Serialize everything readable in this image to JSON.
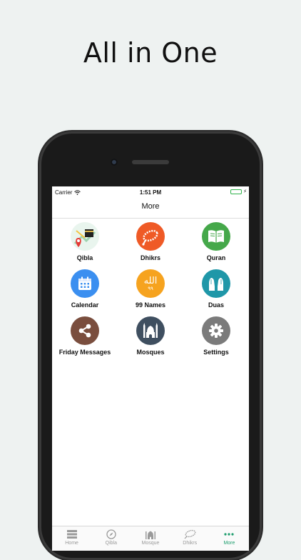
{
  "headline": "All in One",
  "status_bar": {
    "carrier": "Carrier",
    "time": "1:51 PM"
  },
  "nav": {
    "title": "More"
  },
  "menu_items": [
    {
      "label": "Qibla",
      "icon": "kaaba-map-icon",
      "color": "#e9f5ee"
    },
    {
      "label": "Dhikrs",
      "icon": "prayer-beads-icon",
      "color": "#ef5a26"
    },
    {
      "label": "Quran",
      "icon": "book-icon",
      "color": "#45a84a"
    },
    {
      "label": "Calendar",
      "icon": "calendar-icon",
      "color": "#3b8ff0"
    },
    {
      "label": "99 Names",
      "icon": "allah-calligraphy-icon",
      "color": "#f6a31f",
      "icon_text": "الله",
      "icon_subtext": "٩٩"
    },
    {
      "label": "Duas",
      "icon": "praying-hands-icon",
      "color": "#1f97a8"
    },
    {
      "label": "Friday Messages",
      "icon": "share-icon",
      "color": "#7a4e3e"
    },
    {
      "label": "Mosques",
      "icon": "mosque-icon",
      "color": "#3f4f60"
    },
    {
      "label": "Settings",
      "icon": "gear-icon",
      "color": "#7b7b7b"
    }
  ],
  "tab_bar": [
    {
      "label": "Home",
      "icon": "home-icon",
      "active": false
    },
    {
      "label": "Qibla",
      "icon": "compass-icon",
      "active": false
    },
    {
      "label": "Mosque",
      "icon": "mosque-icon",
      "active": false
    },
    {
      "label": "Dhikrs",
      "icon": "prayer-beads-icon",
      "active": false
    },
    {
      "label": "More",
      "icon": "more-dots-icon",
      "active": true
    }
  ],
  "colors": {
    "accent": "#1f9e6e",
    "battery": "#2fb34a"
  }
}
